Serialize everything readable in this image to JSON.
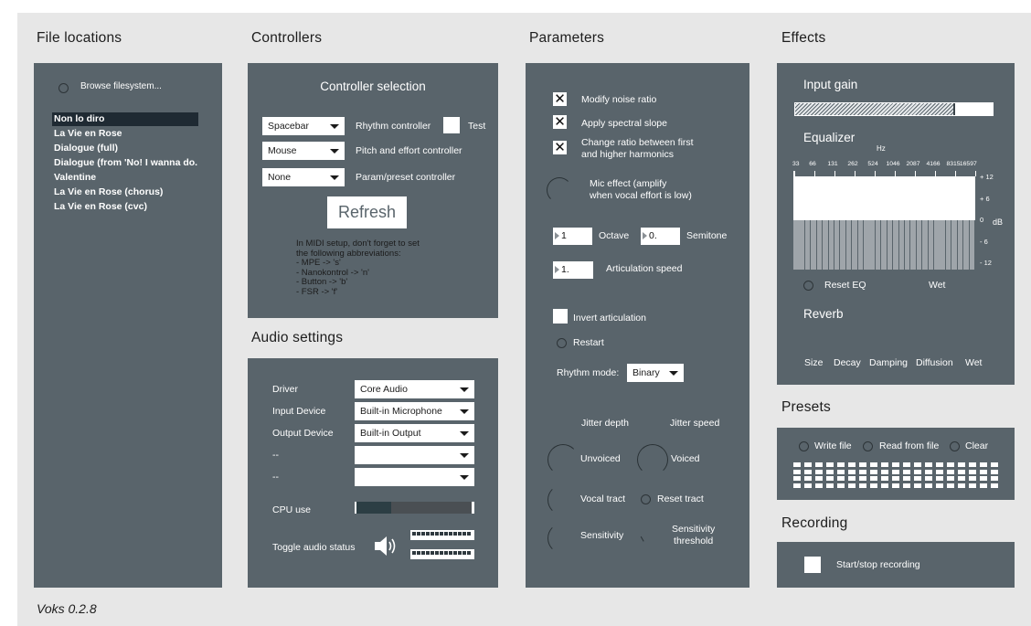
{
  "app": {
    "version_label": "Voks 0.2.8"
  },
  "sections": {
    "file_locations": "File locations",
    "controllers": "Controllers",
    "parameters": "Parameters",
    "effects": "Effects",
    "audio_settings": "Audio settings",
    "presets": "Presets",
    "recording": "Recording"
  },
  "file_locations": {
    "browse_label": "Browse filesystem...",
    "selected_index": 0,
    "files": [
      "Non lo diro",
      "La Vie en Rose",
      "Dialogue (full)",
      "Dialogue (from 'No! I wanna do.",
      "Valentine",
      "La Vie en Rose (chorus)",
      "La Vie en Rose (cvc)"
    ]
  },
  "controllers": {
    "heading": "Controller selection",
    "rows": [
      {
        "value": "Spacebar",
        "label": "Rhythm controller"
      },
      {
        "value": "Mouse",
        "label": "Pitch and effort controller"
      },
      {
        "value": "None",
        "label": "Param/preset controller"
      }
    ],
    "test_label": "Test",
    "refresh_label": "Refresh",
    "midi_note": [
      "In MIDI setup, don't forget to set",
      "the following abbreviations:",
      "- MPE -> 's'",
      "- Nanokontrol -> 'n'",
      "- Button -> 'b'",
      "- FSR -> 'f'"
    ]
  },
  "audio": {
    "rows": [
      {
        "label": "Driver",
        "value": "Core Audio"
      },
      {
        "label": "Input Device",
        "value": "Built-in Microphone"
      },
      {
        "label": "Output Device",
        "value": "Built-in Output"
      },
      {
        "label": "--",
        "value": ""
      },
      {
        "label": "--",
        "value": ""
      }
    ],
    "cpu_label": "CPU use",
    "cpu_use": 0.3,
    "toggle_label": "Toggle audio status"
  },
  "parameters": {
    "checkboxes": [
      {
        "label": "Modify noise ratio",
        "checked": true
      },
      {
        "label": "Apply spectral slope",
        "checked": true
      },
      {
        "label_line1": "Change ratio between first",
        "label_line2": "and higher harmonics",
        "checked": true
      }
    ],
    "mic_effect_line1": "Mic effect (amplify",
    "mic_effect_line2": "when vocal effort is low)",
    "octave_value": "1",
    "octave_label": "Octave",
    "semitone_value": "0.",
    "semitone_label": "Semitone",
    "articulation_value": "1.",
    "articulation_label": "Articulation speed",
    "invert_label": "Invert articulation",
    "restart_label": "Restart",
    "rhythm_mode_label": "Rhythm mode:",
    "rhythm_mode_value": "Binary",
    "jitter_depth": "Jitter depth",
    "jitter_speed": "Jitter speed",
    "unvoiced": "Unvoiced",
    "voiced": "Voiced",
    "vocal_tract": "Vocal tract",
    "reset_tract": "Reset tract",
    "sensitivity": "Sensitivity",
    "sensitivity_threshold_line1": "Sensitivity",
    "sensitivity_threshold_line2": "threshold"
  },
  "effects": {
    "input_gain": "Input gain",
    "input_gain_level": 0.8,
    "equalizer": "Equalizer",
    "hz_label": "Hz",
    "freqs": [
      "33",
      "66",
      "131",
      "262",
      "524",
      "1046",
      "2087",
      "4166",
      "8315",
      "16597"
    ],
    "db_ticks": [
      "+ 12",
      "+ 6",
      "0",
      "- 6",
      "- 12"
    ],
    "db_label": "dB",
    "reset_eq": "Reset EQ",
    "wet_eq": "Wet",
    "reverb": "Reverb",
    "reverb_params": [
      "Size",
      "Decay",
      "Damping",
      "Diffusion",
      "Wet"
    ]
  },
  "presets": {
    "write_file": "Write file",
    "read_from_file": "Read from file",
    "clear": "Clear"
  },
  "recording": {
    "start_stop": "Start/stop recording"
  },
  "colors": {
    "panel": "#59646b",
    "background": "#e7e7e7",
    "selected_item": "#1f2a33"
  }
}
